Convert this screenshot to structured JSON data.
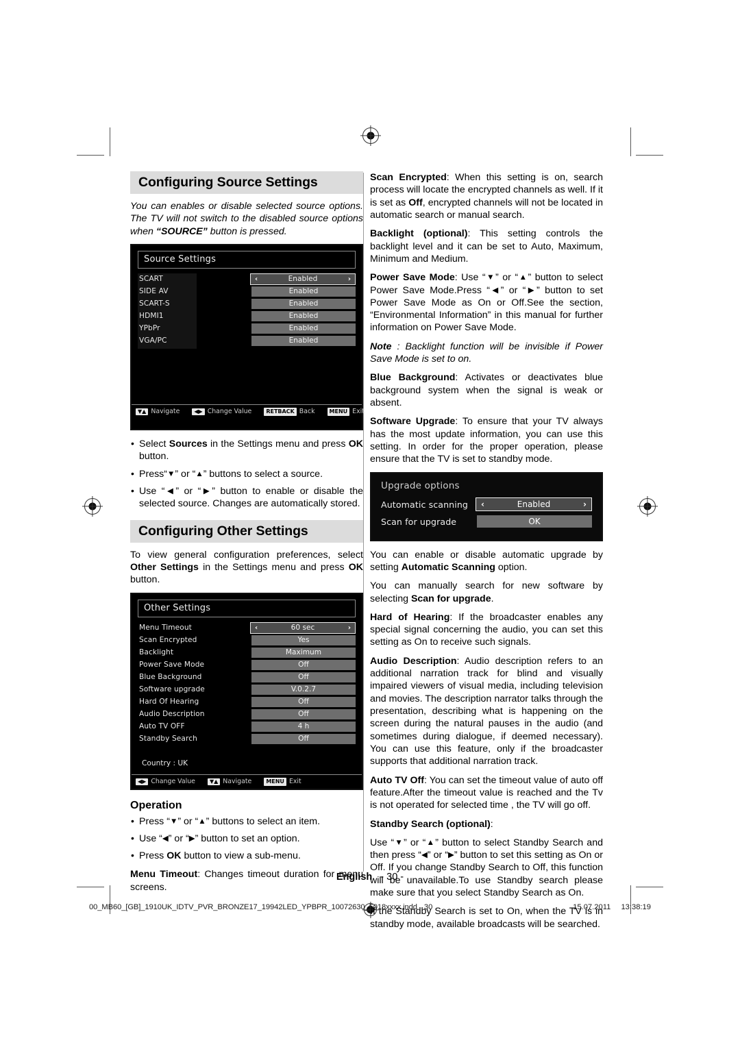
{
  "document": {
    "language_label": "English",
    "page_number": "- 30 -",
    "footer_filename": "00_MB60_[GB]_1910UK_IDTV_PVR_BRONZE17_19942LED_YPBPR_10072630_5018xxxx.indd",
    "footer_page": "30",
    "footer_date": "15.07.2011",
    "footer_time": "13:38:19"
  },
  "left_column": {
    "source_heading": "Configuring Source Settings",
    "source_intro_1": "You can enables or disable selected source options. The TV will not switch to the disabled source options when ",
    "source_intro_bold": "“SOURCE”",
    "source_intro_2": " button is pressed.",
    "source_osd": {
      "title": "Source Settings",
      "rows": [
        {
          "label": "SCART",
          "value": "Enabled",
          "selected": true
        },
        {
          "label": "SIDE AV",
          "value": "Enabled",
          "selected": false
        },
        {
          "label": "SCART-S",
          "value": "Enabled",
          "selected": false
        },
        {
          "label": "HDMI1",
          "value": "Enabled",
          "selected": false
        },
        {
          "label": "YPbPr",
          "value": "Enabled",
          "selected": false
        },
        {
          "label": "VGA/PC",
          "value": "Enabled",
          "selected": false
        }
      ],
      "bar": [
        {
          "keys": "▼▲",
          "label": "Navigate"
        },
        {
          "keys": "◀▶",
          "label": "Change Value"
        },
        {
          "keys": "RETBACK",
          "label": "Back"
        },
        {
          "keys": "MENU",
          "label": "Exit"
        }
      ]
    },
    "source_bullets": [
      {
        "parts": [
          {
            "t": "Select ",
            "s": "n"
          },
          {
            "t": "Sources",
            "s": "b"
          },
          {
            "t": " in the Settings menu and press ",
            "s": "n"
          },
          {
            "t": "OK",
            "s": "b"
          },
          {
            "t": " button.",
            "s": "n"
          }
        ]
      },
      {
        "parts": [
          {
            "t": "Press“",
            "s": "n"
          },
          {
            "t": "▼",
            "s": "a"
          },
          {
            "t": "” or “",
            "s": "n"
          },
          {
            "t": "▲",
            "s": "a"
          },
          {
            "t": "” buttons to select a source.",
            "s": "n"
          }
        ]
      },
      {
        "parts": [
          {
            "t": "Use “",
            "s": "n"
          },
          {
            "t": "◀",
            "s": "a"
          },
          {
            "t": "” or “",
            "s": "n"
          },
          {
            "t": "▶",
            "s": "a"
          },
          {
            "t": "” button to enable or disable the selected source. Changes are automatically stored.",
            "s": "n"
          }
        ]
      }
    ],
    "other_heading": "Configuring Other Settings",
    "other_intro": [
      {
        "t": "To view general configuration preferences, select ",
        "s": "n"
      },
      {
        "t": "Other Settings",
        "s": "b"
      },
      {
        "t": " in the Settings menu and press ",
        "s": "n"
      },
      {
        "t": "OK",
        "s": "b"
      },
      {
        "t": " button.",
        "s": "n"
      }
    ],
    "other_osd": {
      "title": "Other Settings",
      "rows": [
        {
          "label": "Menu Timeout",
          "value": "60 sec",
          "selected": true
        },
        {
          "label": "Scan Encrypted",
          "value": "Yes",
          "selected": false
        },
        {
          "label": "Backlight",
          "value": "Maximum",
          "selected": false
        },
        {
          "label": "Power Save Mode",
          "value": "Off",
          "selected": false
        },
        {
          "label": "Blue Background",
          "value": "Off",
          "selected": false
        },
        {
          "label": "Software upgrade",
          "value": "V.0.2.7",
          "selected": false
        },
        {
          "label": "Hard Of Hearing",
          "value": "Off",
          "selected": false
        },
        {
          "label": "Audio Description",
          "value": "Off",
          "selected": false
        },
        {
          "label": "Auto TV OFF",
          "value": "4 h",
          "selected": false
        },
        {
          "label": "Standby Search",
          "value": "Off",
          "selected": false
        }
      ],
      "country": "Country : UK",
      "bar": [
        {
          "keys": "◀▶",
          "label": "Change Value"
        },
        {
          "keys": "▼▲",
          "label": "Navigate"
        },
        {
          "keys": "MENU",
          "label": "Exit"
        }
      ]
    },
    "operation_heading": "Operation",
    "operation_bullets": [
      {
        "parts": [
          {
            "t": "Press “",
            "s": "n"
          },
          {
            "t": "▼",
            "s": "a"
          },
          {
            "t": "” or “",
            "s": "n"
          },
          {
            "t": "▲",
            "s": "a"
          },
          {
            "t": "” buttons to select an item.",
            "s": "n"
          }
        ]
      },
      {
        "parts": [
          {
            "t": "Use “",
            "s": "n"
          },
          {
            "t": "◀",
            "s": "a"
          },
          {
            "t": "” or “",
            "s": "n"
          },
          {
            "t": "▶",
            "s": "a"
          },
          {
            "t": "” button to set an option.",
            "s": "n"
          }
        ]
      },
      {
        "parts": [
          {
            "t": "Press ",
            "s": "n"
          },
          {
            "t": "OK",
            "s": "b"
          },
          {
            "t": " button to view a sub-menu.",
            "s": "n"
          }
        ]
      }
    ],
    "menu_timeout_para": [
      {
        "t": "Menu Timeout",
        "s": "b"
      },
      {
        "t": ": Changes timeout duration for menu screens.",
        "s": "n"
      }
    ]
  },
  "right_column": {
    "paragraphs_top": [
      {
        "parts": [
          {
            "t": "Scan Encrypted",
            "s": "b"
          },
          {
            "t": ": When this setting is on, search process will locate the encrypted channels as well. If it is set as ",
            "s": "n"
          },
          {
            "t": "Off",
            "s": "b"
          },
          {
            "t": ", encrypted channels will not be located in automatic search or manual search.",
            "s": "n"
          }
        ]
      },
      {
        "parts": [
          {
            "t": "Backlight (optional)",
            "s": "b"
          },
          {
            "t": ": This setting controls the backlight level and it can be set to Auto, Maximum, Minimum and Medium.",
            "s": "n"
          }
        ]
      },
      {
        "parts": [
          {
            "t": "Power Save Mode",
            "s": "b"
          },
          {
            "t": ": Use “",
            "s": "n"
          },
          {
            "t": "▼",
            "s": "a"
          },
          {
            "t": "” or “",
            "s": "n"
          },
          {
            "t": "▲",
            "s": "a"
          },
          {
            "t": "” button to select Power Save Mode.Press “",
            "s": "n"
          },
          {
            "t": "◀",
            "s": "a"
          },
          {
            "t": "” or “",
            "s": "n"
          },
          {
            "t": "▶",
            "s": "a"
          },
          {
            "t": "” button to set Power Save Mode as On or Off.See the section, “Environmental Information” in this manual for further information on Power Save Mode.",
            "s": "n"
          }
        ]
      },
      {
        "parts": [
          {
            "t": "Note",
            "s": "bi"
          },
          {
            "t": " : Backlight function will be invisible if Power Save Mode is set to on.",
            "s": "i"
          }
        ]
      },
      {
        "parts": [
          {
            "t": "Blue Background",
            "s": "b"
          },
          {
            "t": ": Activates or deactivates blue background system when the signal is weak or absent.",
            "s": "n"
          }
        ]
      },
      {
        "parts": [
          {
            "t": "Software Upgrade",
            "s": "b"
          },
          {
            "t": ": To ensure that your TV always has the most update information, you can use this setting. In order for the proper operation, please ensure that the TV is set to standby mode.",
            "s": "n"
          }
        ]
      }
    ],
    "upgrade_osd": {
      "title": "Upgrade options",
      "rows": [
        {
          "label": "Automatic scanning",
          "value": "Enabled",
          "selected": true
        },
        {
          "label": "Scan for upgrade",
          "value": "OK",
          "selected": false
        }
      ]
    },
    "paragraphs_bottom": [
      {
        "parts": [
          {
            "t": "You can enable or disable automatic upgrade by setting ",
            "s": "n"
          },
          {
            "t": "Automatic Scanning",
            "s": "b"
          },
          {
            "t": " option.",
            "s": "n"
          }
        ]
      },
      {
        "parts": [
          {
            "t": "You can manually search for new software by selecting ",
            "s": "n"
          },
          {
            "t": "Scan for upgrade",
            "s": "b"
          },
          {
            "t": ".",
            "s": "n"
          }
        ]
      },
      {
        "parts": [
          {
            "t": "Hard of Hearing",
            "s": "b"
          },
          {
            "t": ": If the broadcaster enables any special signal concerning the audio, you can set this setting as On to receive such signals.",
            "s": "n"
          }
        ]
      },
      {
        "parts": [
          {
            "t": "Audio Description",
            "s": "b"
          },
          {
            "t": ": Audio description refers to an additional narration track for blind and visually impaired viewers of visual media, including television and movies. The description narrator talks through the presentation, describing what is happening on the screen during the natural pauses in the audio (and sometimes during dialogue, if deemed necessary). You can use this feature, only if the broadcaster supports that additional narration track.",
            "s": "n"
          }
        ]
      },
      {
        "parts": [
          {
            "t": "Auto TV Off",
            "s": "b"
          },
          {
            "t": ": You can set the timeout value of auto off feature.After the timeout value is reached and the Tv is not operated for selected time , the TV will go off.",
            "s": "n"
          }
        ]
      },
      {
        "parts": [
          {
            "t": "Standby Search (optional)",
            "s": "b"
          },
          {
            "t": ":",
            "s": "n"
          }
        ]
      },
      {
        "parts": [
          {
            "t": "Use “",
            "s": "n"
          },
          {
            "t": "▼",
            "s": "a"
          },
          {
            "t": "” or “",
            "s": "n"
          },
          {
            "t": "▲",
            "s": "a"
          },
          {
            "t": "” button to select Standby Search and then press “",
            "s": "n"
          },
          {
            "t": "◀",
            "s": "a"
          },
          {
            "t": "” or “",
            "s": "n"
          },
          {
            "t": "▶",
            "s": "a"
          },
          {
            "t": "” button to set this setting as On or Off. If you change Standby Search to Off, this function will be unavailable.To use Standby search please make sure that you select Standby Search as On.",
            "s": "n"
          }
        ]
      },
      {
        "parts": [
          {
            "t": "If the Standby Search is set to On, when the TV is in standby mode, available broadcasts will be searched.",
            "s": "n"
          }
        ]
      }
    ]
  }
}
